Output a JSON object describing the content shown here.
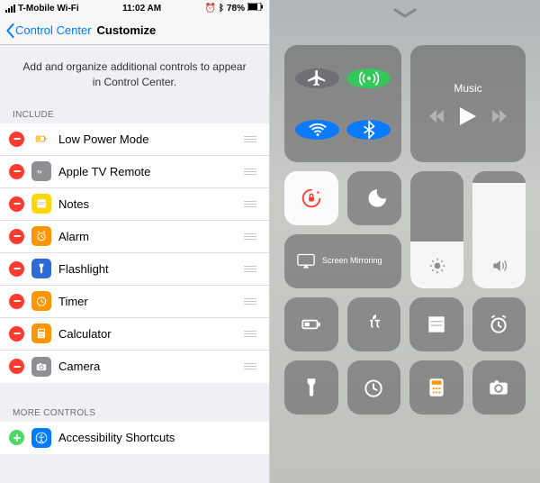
{
  "status": {
    "signal_bars": 4,
    "carrier": "T-Mobile Wi-Fi",
    "time": "11:02 AM",
    "alarm": true,
    "bluetooth": true,
    "battery_pct": "78%"
  },
  "nav": {
    "back_label": "Control Center",
    "title": "Customize"
  },
  "description": "Add and organize additional controls to appear in Control Center.",
  "sections": {
    "include_header": "INCLUDE",
    "more_header": "MORE CONTROLS"
  },
  "include_items": [
    {
      "label": "Low Power Mode",
      "icon": "battery",
      "bg": "#fff",
      "stroke": "#ff9500"
    },
    {
      "label": "Apple TV Remote",
      "icon": "appletv",
      "bg": "#8e8e93"
    },
    {
      "label": "Notes",
      "icon": "notes",
      "bg": "#ffd60a"
    },
    {
      "label": "Alarm",
      "icon": "alarm",
      "bg": "#ff9500"
    },
    {
      "label": "Flashlight",
      "icon": "flashlight",
      "bg": "#2e6bd6"
    },
    {
      "label": "Timer",
      "icon": "timer",
      "bg": "#ff9500"
    },
    {
      "label": "Calculator",
      "icon": "calculator",
      "bg": "#ff9500"
    },
    {
      "label": "Camera",
      "icon": "camera",
      "bg": "#8e8e93"
    }
  ],
  "more_items": [
    {
      "label": "Accessibility Shortcuts",
      "icon": "accessibility",
      "bg": "#007aff"
    }
  ],
  "cc": {
    "music_label": "Music",
    "mirror_label": "Screen Mirroring",
    "connectivity": {
      "airplane_bg": "#6f6f74",
      "cellular_bg": "#34c759",
      "wifi_bg": "#0a7aff",
      "bluetooth_bg": "#0a7aff"
    },
    "brightness_fill_pct": 40,
    "volume_fill_pct": 90,
    "tiles_row3": [
      "low-power",
      "apple-tv",
      "notes",
      "alarm"
    ],
    "tiles_row4": [
      "flashlight",
      "timer",
      "calculator",
      "camera"
    ]
  }
}
